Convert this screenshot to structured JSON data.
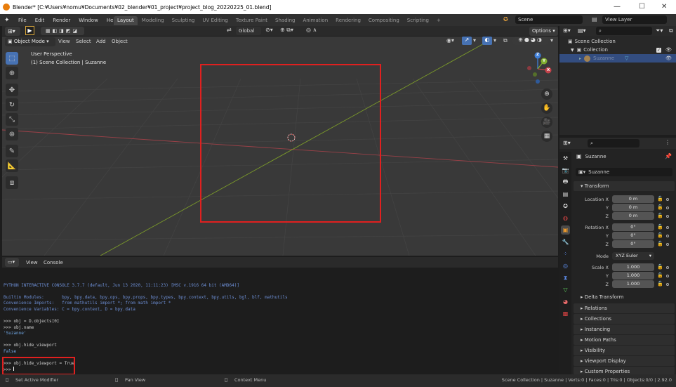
{
  "window": {
    "title": "Blender* [C:¥Users¥nomu¥Documents¥02_blender¥01_project¥project_blog_20220225_01.blend]",
    "minimize": "—",
    "maximize": "☐",
    "close": "✕"
  },
  "menubar": {
    "items": [
      "File",
      "Edit",
      "Render",
      "Window",
      "Help"
    ],
    "workspaces": [
      "Layout",
      "Modeling",
      "Sculpting",
      "UV Editing",
      "Texture Paint",
      "Shading",
      "Animation",
      "Rendering",
      "Compositing",
      "Scripting"
    ],
    "active_workspace": "Layout",
    "add_workspace": "+",
    "scene": "Scene",
    "view_layer": "View Layer"
  },
  "viewport_header": {
    "transform_orientation": "Global",
    "options": "Options",
    "mode": "Object Mode",
    "menus": [
      "View",
      "Select",
      "Add",
      "Object"
    ]
  },
  "viewport": {
    "perspective_label": "User Perspective",
    "collection_label": "(1) Scene Collection | Suzanne",
    "gizmo": {
      "x": "X",
      "y": "Y",
      "z": "Z"
    }
  },
  "console_header": {
    "menus": [
      "View",
      "Console"
    ]
  },
  "console": {
    "lines": [
      {
        "text": "PYTHON INTERACTIVE CONSOLE 3.7.7 (default, Jun 13 2020, 11:11:23) [MSC v.1916 64 bit (AMD64)]",
        "kind": "info"
      },
      {
        "text": "Builtin Modules:       bpy, bpy.data, bpy.ops, bpy.props, bpy.types, bpy.context, bpy.utils, bgl, blf, mathutils",
        "kind": "info"
      },
      {
        "text": "Convenience Imports:   from mathutils import *; from math import *",
        "kind": "info"
      },
      {
        "text": "Convenience Variables: C = bpy.context, D = bpy.data",
        "kind": "info"
      },
      {
        "text": ">>> obj = D.objects[0]",
        "kind": "in"
      },
      {
        "text": ">>> obj.name",
        "kind": "in"
      },
      {
        "text": "'Suzanne'",
        "kind": "out"
      },
      {
        "text": ">>> obj.hide_viewport",
        "kind": "in"
      },
      {
        "text": "False",
        "kind": "out"
      },
      {
        "text": ">>> obj.hide_viewport = True",
        "kind": "in"
      },
      {
        "text": ">>> ",
        "kind": "in"
      }
    ]
  },
  "statusbar": {
    "left": "Set Active Modifier",
    "middle": "Pan View",
    "right_hint": "Context Menu",
    "stats": "Scene Collection | Suzanne | Verts:0 | Faces:0 | Tris:0 | Objects:0/0 | 2.92.0"
  },
  "outliner": {
    "root": "Scene Collection",
    "collection": "Collection",
    "object": "Suzanne"
  },
  "properties": {
    "object_name": "Suzanne",
    "datablock": "Suzanne",
    "transform_title": "Transform",
    "location_label": "Location X",
    "location": [
      "0 m",
      "0 m",
      "0 m"
    ],
    "rotation_label": "Rotation X",
    "rotation": [
      "0°",
      "0°",
      "0°"
    ],
    "mode_label": "Mode",
    "mode_value": "XYZ Euler",
    "scale_label": "Scale X",
    "scale": [
      "1.000",
      "1.000",
      "1.000"
    ],
    "axis_y": "Y",
    "axis_z": "Z",
    "delta_transform": "Delta Transform",
    "panels": [
      "Relations",
      "Collections",
      "Instancing",
      "Motion Paths",
      "Visibility",
      "Viewport Display",
      "Custom Properties"
    ]
  },
  "colors": {
    "highlight_red": "#e0201f",
    "active_blue": "#4772b3",
    "x_axis": "#c4424a",
    "y_axis": "#82b030",
    "z_axis": "#3f7fd8"
  }
}
